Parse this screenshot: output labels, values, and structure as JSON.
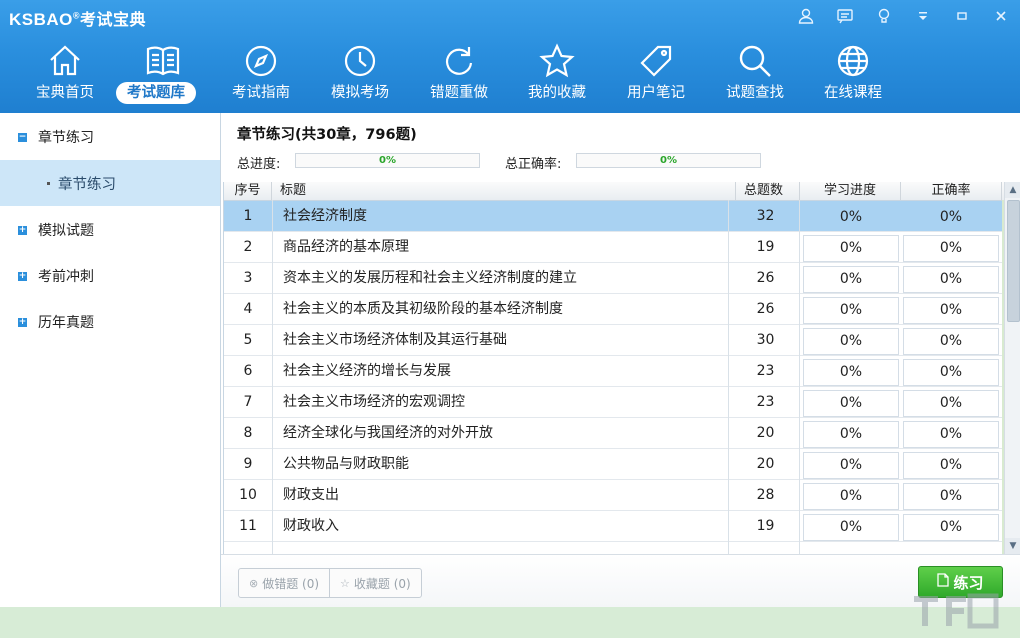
{
  "app": {
    "logo_en": "KSBAO",
    "logo_mark": "®",
    "logo_cn": "考试宝典"
  },
  "window_controls": [
    "user-icon",
    "message-icon",
    "bulb-icon",
    "dropdown-icon",
    "minimize-icon",
    "close-icon"
  ],
  "nav": {
    "items": [
      {
        "label": "宝典首页",
        "icon": "home-icon"
      },
      {
        "label": "考试题库",
        "icon": "book-icon",
        "active": true
      },
      {
        "label": "考试指南",
        "icon": "compass-icon"
      },
      {
        "label": "模拟考场",
        "icon": "clock-icon"
      },
      {
        "label": "错题重做",
        "icon": "refresh-icon"
      },
      {
        "label": "我的收藏",
        "icon": "star-icon"
      },
      {
        "label": "用户笔记",
        "icon": "tag-icon"
      },
      {
        "label": "试题查找",
        "icon": "search-icon"
      },
      {
        "label": "在线课程",
        "icon": "globe-icon"
      }
    ]
  },
  "sidebar": {
    "items": [
      {
        "label": "章节练习",
        "expander": "−"
      },
      {
        "label": "章节练习"
      },
      {
        "label": "模拟试题",
        "expander": "+"
      },
      {
        "label": "考前冲刺",
        "expander": "+"
      },
      {
        "label": "历年真题",
        "expander": "+"
      }
    ]
  },
  "content": {
    "title": "章节练习(共30章，796题)",
    "total_progress_label": "总进度:",
    "total_progress_value": "0%",
    "total_accuracy_label": "总正确率:",
    "total_accuracy_value": "0%"
  },
  "table": {
    "headers": [
      "序号",
      "标题",
      "总题数",
      "学习进度",
      "正确率"
    ],
    "rows": [
      {
        "no": "1",
        "title": "社会经济制度",
        "total": "32",
        "progress": "0%",
        "accuracy": "0%"
      },
      {
        "no": "2",
        "title": "商品经济的基本原理",
        "total": "19",
        "progress": "0%",
        "accuracy": "0%"
      },
      {
        "no": "3",
        "title": "资本主义的发展历程和社会主义经济制度的建立",
        "total": "26",
        "progress": "0%",
        "accuracy": "0%"
      },
      {
        "no": "4",
        "title": "社会主义的本质及其初级阶段的基本经济制度",
        "total": "26",
        "progress": "0%",
        "accuracy": "0%"
      },
      {
        "no": "5",
        "title": "社会主义市场经济体制及其运行基础",
        "total": "30",
        "progress": "0%",
        "accuracy": "0%"
      },
      {
        "no": "6",
        "title": "社会主义经济的增长与发展",
        "total": "23",
        "progress": "0%",
        "accuracy": "0%"
      },
      {
        "no": "7",
        "title": "社会主义市场经济的宏观调控",
        "total": "23",
        "progress": "0%",
        "accuracy": "0%"
      },
      {
        "no": "8",
        "title": "经济全球化与我国经济的对外开放",
        "total": "20",
        "progress": "0%",
        "accuracy": "0%"
      },
      {
        "no": "9",
        "title": "公共物品与财政职能",
        "total": "20",
        "progress": "0%",
        "accuracy": "0%"
      },
      {
        "no": "10",
        "title": "财政支出",
        "total": "28",
        "progress": "0%",
        "accuracy": "0%"
      },
      {
        "no": "11",
        "title": "财政收入",
        "total": "19",
        "progress": "0%",
        "accuracy": "0%"
      }
    ]
  },
  "bottom": {
    "wrong_btn": "做错题 (0)",
    "fav_btn": "收藏题 (0)",
    "practice_btn": "练习"
  },
  "colors": {
    "header_blue": "#2a8fde",
    "selected_row": "#a9d2f2",
    "practice_green": "#3fb536"
  }
}
